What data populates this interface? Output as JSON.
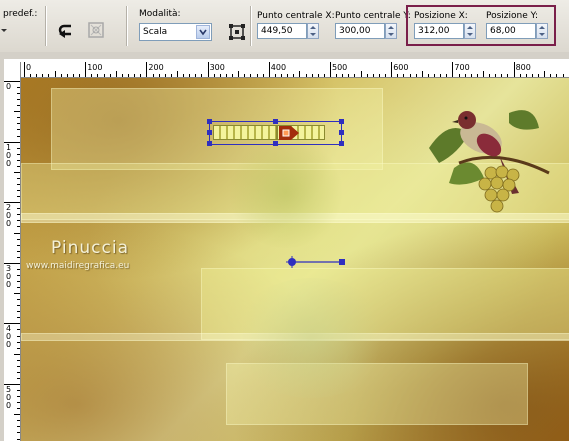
{
  "toolbar": {
    "preset_label": "predef.:",
    "mode_label": "Modalità:",
    "mode_value": "Scala",
    "center_x_label": "Punto centrale X:",
    "center_x_value": "449,50",
    "center_y_label": "Punto centrale Y:",
    "center_y_value": "300,00",
    "pos_x_label": "Posizione X:",
    "pos_x_value": "312,00",
    "pos_y_label": "Posizione Y:",
    "pos_y_value": "68,00",
    "highlight_color": "#7a1f4a"
  },
  "ruler_top": {
    "labels": [
      "0",
      "100",
      "200",
      "300",
      "400",
      "500",
      "600",
      "700",
      "800"
    ]
  },
  "ruler_left": {
    "labels": [
      "0",
      "100",
      "200",
      "300",
      "400",
      "500"
    ]
  },
  "watermark": {
    "name": "Pinuccia",
    "url": "www.maidiregrafica.eu"
  },
  "icons": [
    "undo-icon",
    "reset-icon",
    "deform-icon",
    "spinner-up-icon",
    "spinner-down-icon",
    "dropdown-arrow-icon",
    "bird-icon",
    "grapes-icon"
  ],
  "colors": {
    "handle": "#2f2fbf",
    "arrow": "#a32e0c",
    "selection_fill": "#e7e78a"
  }
}
